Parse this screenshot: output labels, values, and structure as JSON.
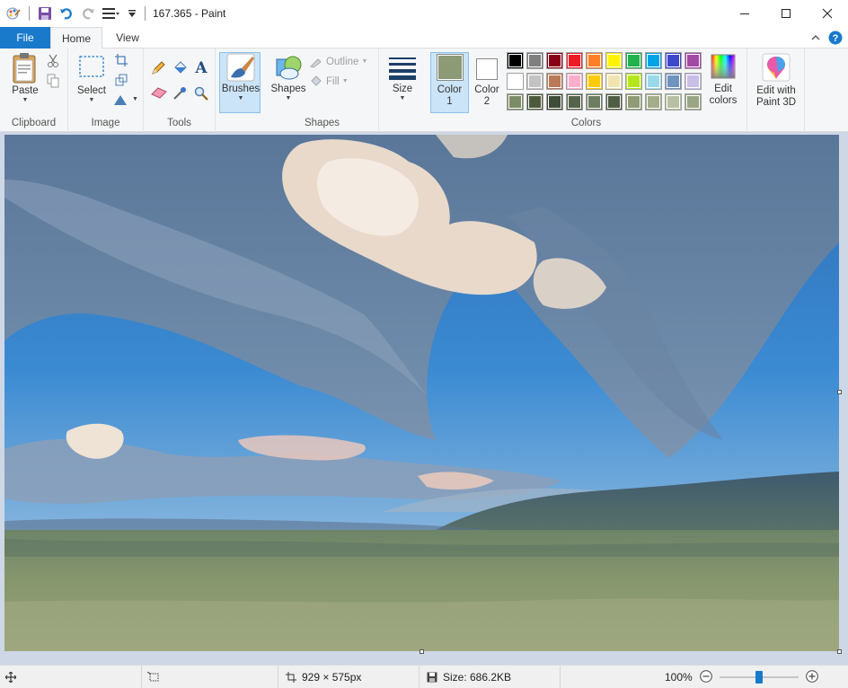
{
  "window": {
    "title": "167.365 - Paint"
  },
  "tabs": {
    "file": "File",
    "home": "Home",
    "view": "View"
  },
  "ribbon": {
    "clipboard": {
      "paste": "Paste",
      "group": "Clipboard"
    },
    "image": {
      "select": "Select",
      "group": "Image"
    },
    "tools": {
      "group": "Tools"
    },
    "brushes": {
      "label": "Brushes"
    },
    "shapes": {
      "shapes": "Shapes",
      "outline": "Outline",
      "fill": "Fill",
      "group": "Shapes"
    },
    "size": {
      "label": "Size"
    },
    "colors": {
      "color1_line1": "Color",
      "color1_line2": "1",
      "color2_line1": "Color",
      "color2_line2": "2",
      "edit_line1": "Edit",
      "edit_line2": "colors",
      "group": "Colors",
      "color1_value": "#8c9a75",
      "color2_value": "#ffffff",
      "row1": [
        "#000000",
        "#7f7f7f",
        "#880015",
        "#ed1c24",
        "#ff7f27",
        "#fff200",
        "#22b14c",
        "#00a2e8",
        "#3f48cc",
        "#a349a4"
      ],
      "row2": [
        "#ffffff",
        "#c3c3c3",
        "#b97a57",
        "#ffaec9",
        "#ffc90e",
        "#efe4b0",
        "#b5e61d",
        "#99d9ea",
        "#7092be",
        "#c8bfe7"
      ],
      "row3": [
        "#7d8c68",
        "#4b5a3c",
        "#3e4b36",
        "#55634a",
        "#6f7d62",
        "#4e5d44",
        "#8f9b77",
        "#a3ad8a",
        "#b8c0a3",
        "#9aa585"
      ]
    },
    "paint3d": {
      "line1": "Edit with",
      "line2": "Paint 3D"
    }
  },
  "status": {
    "dimensions": "929 × 575px",
    "size": "Size: 686.2KB",
    "zoom": "100%",
    "zoom_slider_level": 0.5
  }
}
